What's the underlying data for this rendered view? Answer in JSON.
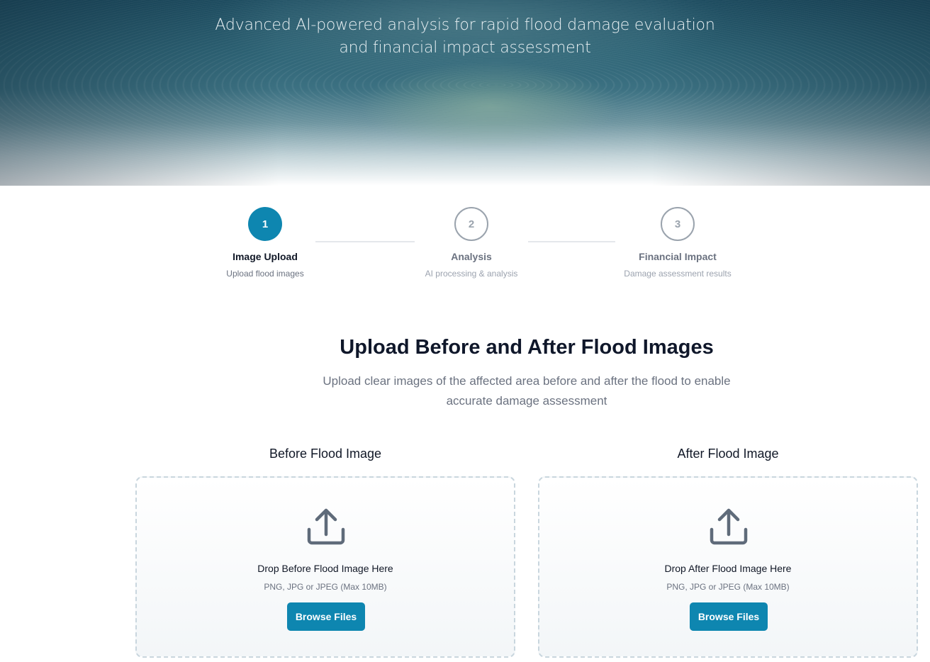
{
  "hero": {
    "subtitle_line1": "Advanced AI-powered analysis for rapid flood damage evaluation",
    "subtitle_line2": "and financial impact assessment"
  },
  "stepper": {
    "steps": [
      {
        "number": "1",
        "title": "Image Upload",
        "description": "Upload flood images",
        "state": "active"
      },
      {
        "number": "2",
        "title": "Analysis",
        "description": "AI processing & analysis",
        "state": "inactive"
      },
      {
        "number": "3",
        "title": "Financial Impact",
        "description": "Damage assessment results",
        "state": "inactive"
      }
    ]
  },
  "section": {
    "title": "Upload Before and After Flood Images",
    "subtitle": "Upload clear images of the affected area before and after the flood to enable accurate damage assessment"
  },
  "uploads": [
    {
      "label": "Before Flood Image",
      "drop_title": "Drop Before Flood Image Here",
      "hint": "PNG, JPG or JPEG (Max 10MB)",
      "button": "Browse Files",
      "icon": "upload-icon"
    },
    {
      "label": "After Flood Image",
      "drop_title": "Drop After Flood Image Here",
      "hint": "PNG, JPG or JPEG (Max 10MB)",
      "button": "Browse Files",
      "icon": "upload-icon"
    }
  ],
  "colors": {
    "accent": "#0e86b0",
    "heading": "#0f172a",
    "muted": "#6b7280",
    "dropzone_border": "#c9d6de"
  }
}
